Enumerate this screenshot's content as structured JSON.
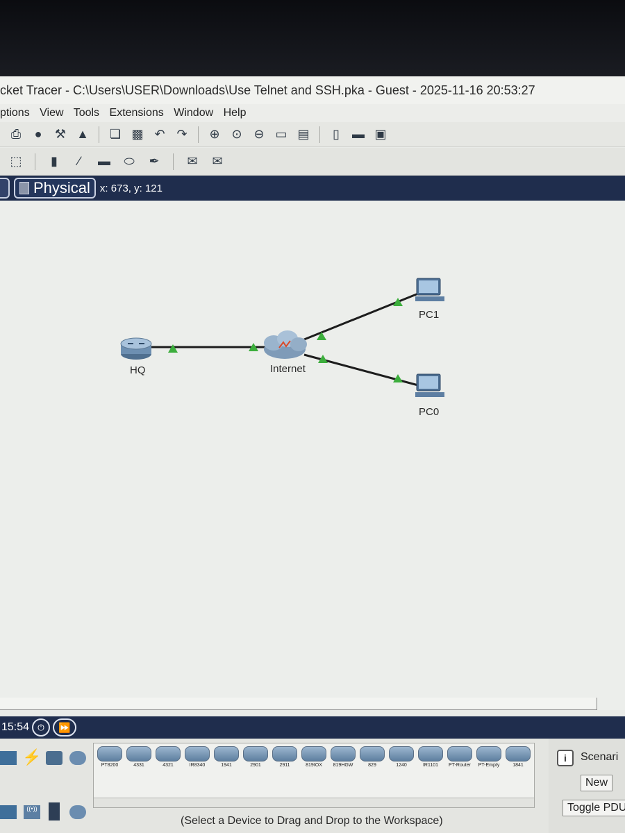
{
  "window": {
    "title": "cket Tracer - C:\\Users\\USER\\Downloads\\Use Telnet and SSH.pka - Guest - 2025-11-16 20:53:27"
  },
  "menu": [
    "ptions",
    "View",
    "Tools",
    "Extensions",
    "Window",
    "Help"
  ],
  "toolbar_icons": [
    "print-icon",
    "info-icon",
    "activity-wizard-icon",
    "custom-device-icon",
    "copy-icon",
    "paste-icon",
    "undo-icon",
    "redo-icon",
    "zoom-in-icon",
    "zoom-reset-icon",
    "zoom-out-icon",
    "drawing-palette-icon",
    "custom-devices-dialog-icon",
    "viewport-icon",
    "cluster-icon",
    "background-image-icon"
  ],
  "toolbar2_icons": [
    "select-icon",
    "note-icon",
    "line-icon",
    "rectangle-icon",
    "ellipse-icon",
    "freeform-icon",
    "simple-pdu-icon",
    "complex-pdu-icon"
  ],
  "workspace": {
    "mode_label": "Physical",
    "coords": "x: 673, y: 121",
    "devices": [
      {
        "name": "HQ",
        "type": "router"
      },
      {
        "name": "Internet",
        "type": "cloud"
      },
      {
        "name": "PC1",
        "type": "pc"
      },
      {
        "name": "PC0",
        "type": "pc"
      }
    ],
    "link_color": "#1d1d1d",
    "link_status_color": "#3cae3c"
  },
  "timebar": {
    "time": "15:54"
  },
  "device_panel": {
    "models": [
      "PT8200",
      "4331",
      "4321",
      "IR8340",
      "1941",
      "2901",
      "2911",
      "819IOX",
      "819HGW",
      "829",
      "1240",
      "IR1101",
      "PT-Router",
      "PT-Empty",
      "1841"
    ],
    "hint": "(Select a Device to Drag and Drop to the Workspace)"
  },
  "scenario_panel": {
    "scenario_label": "Scenari",
    "new_label": "New",
    "toggle_pdu_label": "Toggle PDU"
  }
}
